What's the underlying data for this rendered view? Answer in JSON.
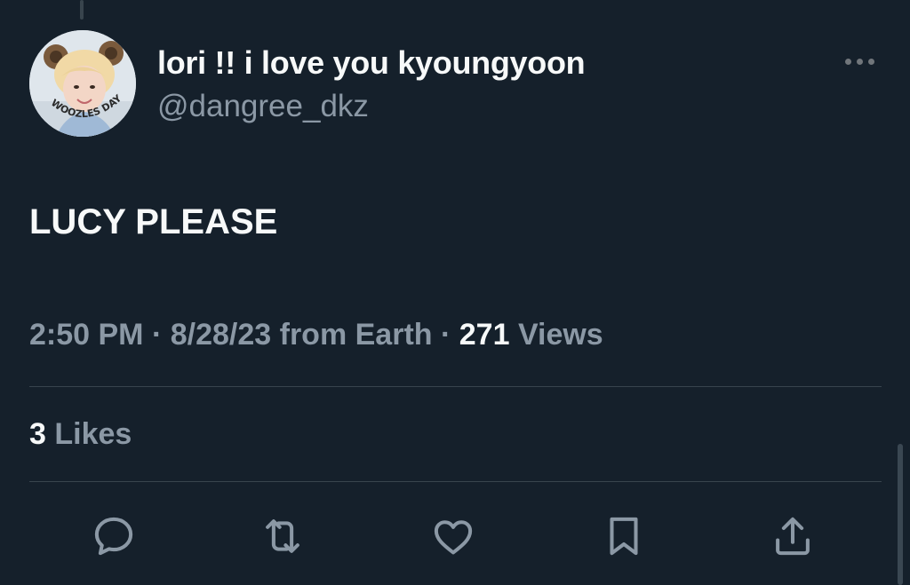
{
  "tweet": {
    "display_name": "lori !! i love you kyoungyoon",
    "handle": "@dangree_dkz",
    "text": "LUCY PLEASE",
    "time": "2:50 PM",
    "separator": " · ",
    "date": "8/28/23",
    "source_prefix": " from ",
    "source": "Earth",
    "views_count": "271",
    "views_label": " Views",
    "likes_count": "3",
    "likes_label": " Likes",
    "avatar_text": "WOOZLES DAY"
  },
  "icons": {
    "more": "more-horizontal-icon",
    "reply": "reply-icon",
    "retweet": "retweet-icon",
    "like": "heart-icon",
    "bookmark": "bookmark-icon",
    "share": "share-icon"
  },
  "colors": {
    "background": "#15202b",
    "primary_text": "#f7f9f9",
    "secondary_text": "#8b98a5",
    "divider": "#38444d",
    "icon": "#8b98a5"
  }
}
